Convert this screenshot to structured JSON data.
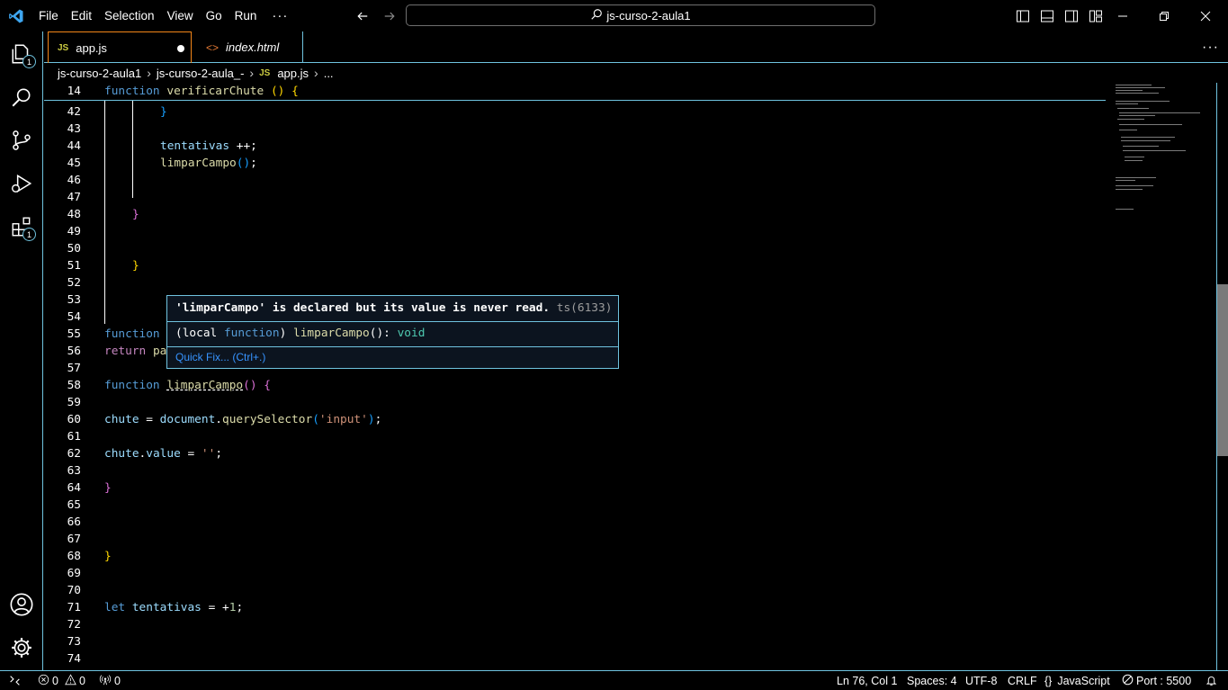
{
  "titlebar": {
    "menu": [
      "File",
      "Edit",
      "Selection",
      "View",
      "Go",
      "Run"
    ],
    "more": "···",
    "search_text": "js-curso-2-aula1"
  },
  "activity": {
    "explorer_badge": "1",
    "extensions_badge": "1"
  },
  "tabs": [
    {
      "icon": "JS",
      "label": "app.js",
      "dirty": true
    },
    {
      "icon": "<>",
      "label": "index.html"
    }
  ],
  "tabs_more": "···",
  "breadcrumb": {
    "folder": "js-curso-2-aula1",
    "subfolder": "js-curso-2-aula_-",
    "file_icon": "JS",
    "file": "app.js",
    "ellipsis": "..."
  },
  "editor": {
    "sticky": {
      "num": "14"
    },
    "lines": [
      "42",
      "43",
      "44",
      "45",
      "46",
      "47",
      "48",
      "49",
      "50",
      "51",
      "52",
      "53",
      "54",
      "55",
      "56",
      "57",
      "58",
      "59",
      "60",
      "61",
      "62",
      "63",
      "64",
      "65",
      "66",
      "67",
      "68",
      "69",
      "70",
      "71",
      "72",
      "73",
      "74"
    ]
  },
  "hover": {
    "message": "'limparCampo' is declared but its value is never read.",
    "code": "ts(6133)",
    "signature_open": "(local ",
    "signature_kw": "function",
    "signature_close": ") ",
    "signature_fn": "limparCampo",
    "signature_paren": "(): ",
    "signature_type": "void",
    "quick_fix": "Quick Fix... (Ctrl+.)"
  },
  "statusbar": {
    "errors": "0",
    "warnings": "0",
    "ports": "0",
    "position": "Ln 76, Col 1",
    "spaces": "Spaces: 4",
    "encoding": "UTF-8",
    "eol": "CRLF",
    "language": "JavaScript",
    "port": "Port : 5500"
  },
  "colors": {
    "accent_border": "#6fc3df",
    "active_tab_border": "#f38518",
    "keyword": "#569cd6",
    "function": "#dcdcaa",
    "string": "#ce9178"
  }
}
